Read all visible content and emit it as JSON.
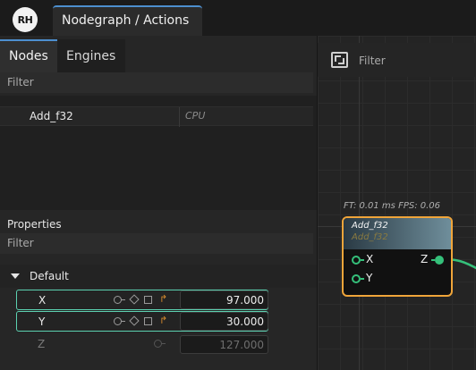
{
  "app": {
    "logo_text": "RH",
    "document_tab": "Nodegraph / Actions"
  },
  "left_panel": {
    "tabs": [
      {
        "label": "Nodes",
        "active": true
      },
      {
        "label": "Engines",
        "active": false
      }
    ],
    "nodes_filter_placeholder": "Filter",
    "nodes": [
      {
        "name": "Add_f32",
        "engine": "CPU"
      }
    ],
    "properties": {
      "title": "Properties",
      "filter_placeholder": "Filter",
      "group": "Default",
      "items": [
        {
          "label": "X",
          "value": "97.000",
          "selected": true,
          "enabled": true
        },
        {
          "label": "Y",
          "value": "30.000",
          "selected": true,
          "enabled": true
        },
        {
          "label": "Z",
          "value": "127.000",
          "selected": false,
          "enabled": false
        }
      ]
    }
  },
  "canvas": {
    "filter_placeholder": "Filter",
    "stats": "FT: 0.01 ms FPS: 0.06",
    "node": {
      "title": "Add_f32",
      "subtitle": "Add_f32",
      "inputs": [
        "X",
        "Y"
      ],
      "outputs": [
        "Z"
      ]
    }
  },
  "colors": {
    "accent_tab": "#4d8fcf",
    "selection": "#5cd1b1",
    "node_border": "#f0a53a",
    "pin": "#35c07a",
    "link_icon": "#d58a2c"
  }
}
